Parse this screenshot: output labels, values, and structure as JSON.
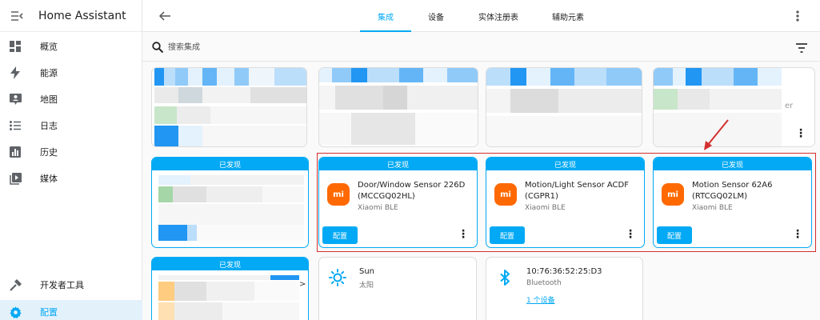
{
  "app": {
    "title": "Home Assistant"
  },
  "sidebar": {
    "items": [
      {
        "label": "概览",
        "icon": "dashboard-icon"
      },
      {
        "label": "能源",
        "icon": "lightning-bolt-icon"
      },
      {
        "label": "地图",
        "icon": "map-account-icon"
      },
      {
        "label": "日志",
        "icon": "format-list-bulleted-icon"
      },
      {
        "label": "历史",
        "icon": "chart-box-icon"
      },
      {
        "label": "媒体",
        "icon": "play-box-icon"
      }
    ],
    "bottom_items": [
      {
        "label": "开发者工具",
        "icon": "hammer-icon"
      },
      {
        "label": "配置",
        "icon": "cog-icon",
        "active": true
      }
    ]
  },
  "tabs": [
    {
      "label": "集成",
      "active": true
    },
    {
      "label": "设备"
    },
    {
      "label": "实体注册表"
    },
    {
      "label": "辅助元素"
    }
  ],
  "search": {
    "placeholder": "搜索集成"
  },
  "discovered_label": "已发现",
  "xiaomi_cards": [
    {
      "name": "Door/Window Sensor 226D (MCCGQ02HL)",
      "integration": "Xiaomi BLE",
      "logo": "mi",
      "button": "配置"
    },
    {
      "name": "Motion/Light Sensor ACDF (CGPR1)",
      "integration": "Xiaomi BLE",
      "logo": "mi",
      "button": "配置"
    },
    {
      "name": "Motion Sensor 62A6 (RTCGQ02LM)",
      "integration": "Xiaomi BLE",
      "logo": "mi",
      "button": "配置"
    }
  ],
  "integrations": [
    {
      "name": "Sun",
      "subtitle": "太阳",
      "icon": "sun-icon"
    },
    {
      "name": "10:76:36:52:25:D3",
      "subtitle": "Bluetooth",
      "link": "1 个设备",
      "icon": "bluetooth-icon"
    }
  ],
  "blurred_fragments": {
    "card4": "er",
    "card7": ">"
  },
  "colors": {
    "accent": "#03a9f4",
    "xiaomi": "#ff6900",
    "highlight": "#d32f2f"
  }
}
